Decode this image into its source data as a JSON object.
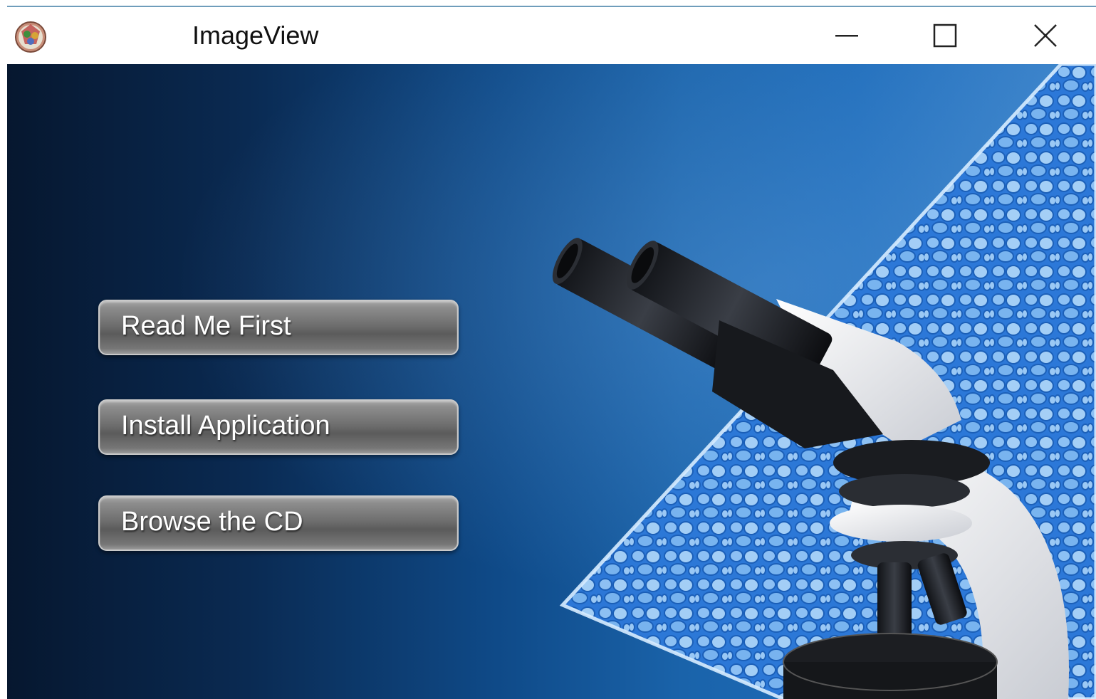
{
  "window": {
    "title": "ImageView",
    "icon": "app-icon",
    "controls": {
      "minimize_icon": "minimize-icon",
      "maximize_icon": "maximize-icon",
      "close_icon": "close-icon"
    }
  },
  "menu": {
    "items": [
      {
        "label": "Read Me First"
      },
      {
        "label": "Install Application"
      },
      {
        "label": "Browse the CD"
      }
    ]
  },
  "artwork": {
    "illustration": "microscope",
    "background": "blue-cell-tissue"
  },
  "colors": {
    "background_dark": "#06172f",
    "background_light": "#3f86cc",
    "button_gray": "#6c6c6c",
    "tissue_blue": "#2f7fe0"
  }
}
